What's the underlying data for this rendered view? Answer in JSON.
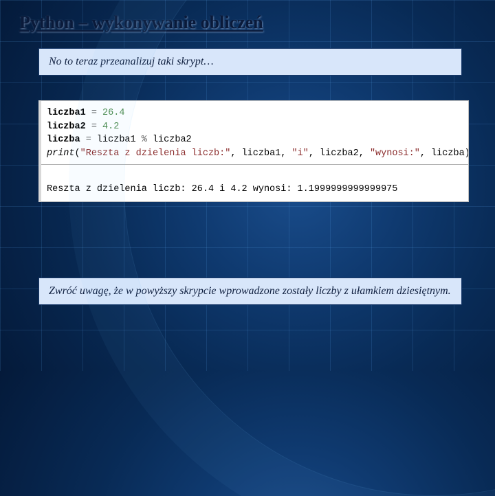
{
  "title": "Python – wykonywanie obliczeń",
  "note_top": "No to teraz przeanalizuj taki skrypt…",
  "code": {
    "l1_var": "liczba1",
    "l1_eq": " = ",
    "l1_val": "26.4",
    "l2_var": "liczba2",
    "l2_eq": " = ",
    "l2_val": "4.2",
    "l3_var": "liczba",
    "l3_eq": " = ",
    "l3_a": "liczba1",
    "l3_op": " % ",
    "l3_b": "liczba2",
    "l4_fn": "print",
    "l4_p1": "(",
    "l4_s1": "\"Reszta z dzielenia liczb:\"",
    "l4_c1": ", ",
    "l4_v1": "liczba1",
    "l4_c2": ", ",
    "l4_s2": "\"i\"",
    "l4_c3": ", ",
    "l4_v2": "liczba2",
    "l4_c4": ", ",
    "l4_s3": "\"wynosi:\"",
    "l4_c5": ", ",
    "l4_v3": "liczba",
    "l4_p2": ")",
    "output": "Reszta z dzielenia liczb: 26.4 i 4.2 wynosi: 1.1999999999999975"
  },
  "note_bottom": "Zwróć uwagę, że w powyższy skrypcie wprowadzone zostały liczby z ułamkiem dziesiętnym."
}
